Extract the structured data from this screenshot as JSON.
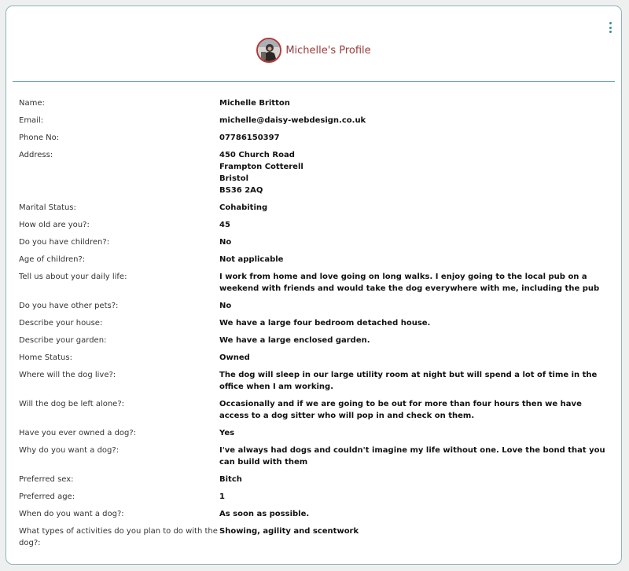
{
  "header": {
    "title": "Michelle's Profile"
  },
  "colors": {
    "accent": "#4f9aa1",
    "title": "#9a3a3a",
    "avatar_border": "#b23a3a"
  },
  "icons": {
    "menu": "kebab-menu-icon",
    "avatar": "avatar-photo"
  },
  "fields": [
    {
      "label": "Name:",
      "value": "Michelle Britton"
    },
    {
      "label": "Email:",
      "value": "michelle@daisy-webdesign.co.uk"
    },
    {
      "label": "Phone No:",
      "value": "07786150397"
    },
    {
      "label": "Address:",
      "value": "450 Church Road\nFrampton Cotterell\nBristol\nBS36 2AQ"
    },
    {
      "label": "Marital Status:",
      "value": "Cohabiting"
    },
    {
      "label": "How old are you?:",
      "value": "45"
    },
    {
      "label": "Do you have children?:",
      "value": "No"
    },
    {
      "label": "Age of children?:",
      "value": "Not applicable"
    },
    {
      "label": "Tell us about your daily life:",
      "value": "I work from home and love going on long walks. I enjoy going to the local pub on a weekend with friends and would take the dog everywhere with me, including the pub"
    },
    {
      "label": "Do you have other pets?:",
      "value": "No"
    },
    {
      "label": "Describe your house:",
      "value": "We have a large four bedroom detached house."
    },
    {
      "label": "Describe your garden:",
      "value": "We have a large enclosed garden."
    },
    {
      "label": "Home Status:",
      "value": "Owned"
    },
    {
      "label": "Where will the dog live?:",
      "value": "The dog will sleep in our large utility room at night but will spend a lot of time in the office when I am working."
    },
    {
      "label": "Will the dog be left alone?:",
      "value": "Occasionally and if we are going to be out for more than four hours then we have access to a dog sitter who will pop in and check on them."
    },
    {
      "label": "Have you ever owned a dog?:",
      "value": "Yes"
    },
    {
      "label": "Why do you want a dog?:",
      "value": "I've always had dogs and couldn't imagine my life without one. Love the bond that you can build with them"
    },
    {
      "label": "Preferred sex:",
      "value": "Bitch"
    },
    {
      "label": "Preferred age:",
      "value": "1"
    },
    {
      "label": "When do you want a dog?:",
      "value": "As soon as possible."
    },
    {
      "label": "What types of activities do you plan to do with the dog?:",
      "value": "Showing, agility and scentwork"
    }
  ]
}
